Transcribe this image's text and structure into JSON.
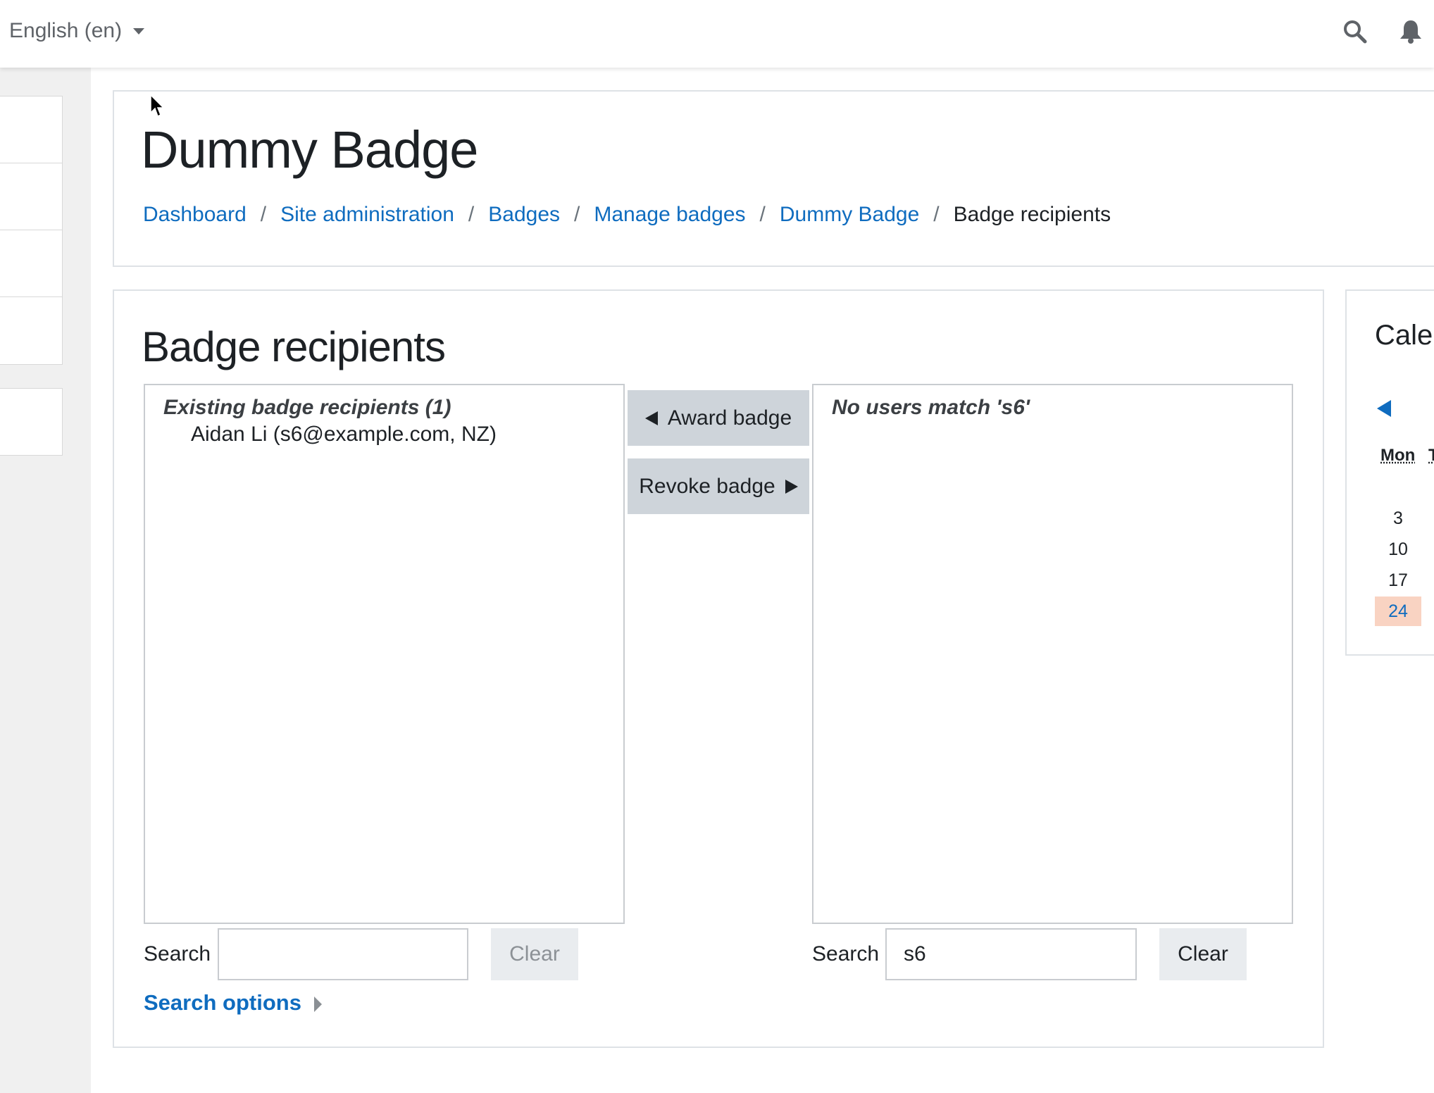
{
  "navbar": {
    "language": "English (en)",
    "icons": [
      "search-icon",
      "bell-icon"
    ]
  },
  "header": {
    "title": "Dummy Badge",
    "breadcrumb": [
      {
        "label": "Dashboard"
      },
      {
        "label": "Site administration"
      },
      {
        "label": "Badges"
      },
      {
        "label": "Manage badges"
      },
      {
        "label": "Dummy Badge"
      },
      {
        "label": "Badge recipients"
      }
    ]
  },
  "main": {
    "title": "Badge recipients",
    "existing": {
      "group_label": "Existing badge recipients (1)",
      "options": [
        "Aidan Li (s6@example.com, NZ)"
      ],
      "search_label": "Search",
      "search_value": "",
      "clear_label": "Clear"
    },
    "buttons": {
      "award": "Award badge",
      "revoke": "Revoke badge"
    },
    "potential": {
      "group_label": "No users match 's6'",
      "search_label": "Search",
      "search_value": "s6",
      "clear_label": "Clear"
    },
    "search_options_label": "Search options"
  },
  "calendar": {
    "title": "Calendar",
    "headers": [
      "Mon",
      "T"
    ],
    "days": [
      "3",
      "10",
      "17",
      "24"
    ],
    "today": "24",
    "colors": {
      "today_bg": "#f9d3c2",
      "link": "#0f6cbf"
    }
  }
}
